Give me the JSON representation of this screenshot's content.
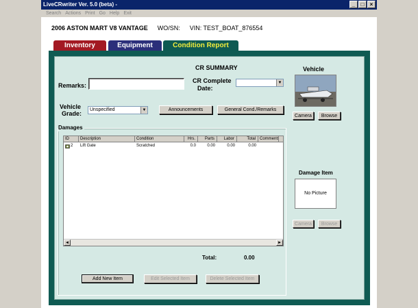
{
  "window": {
    "title": "LiveCRwriter Ver. 5.0 (beta) -"
  },
  "menu": [
    "Search",
    "Actions",
    "Print",
    "Go",
    "Help",
    "Exit"
  ],
  "vehicle_header": {
    "year_make_model": "2006 ASTON MART V8 VANTAGE",
    "wo_label": "WO/SN:",
    "vin": "VIN: TEST_BOAT_876554"
  },
  "tabs": [
    {
      "label": "Inventory",
      "color": "#a31923"
    },
    {
      "label": "Equipment",
      "color": "#2b2f7a"
    },
    {
      "label": "Condition Report",
      "color": "#0e5a52",
      "selected": true
    }
  ],
  "cr": {
    "summary_title": "CR SUMMARY",
    "remarks_label": "Remarks:",
    "remarks_value": "",
    "complete_date_label_1": "CR Complete",
    "complete_date_label_2": "Date:",
    "complete_date_value": "",
    "grade_label_1": "Vehicle",
    "grade_label_2": "Grade:",
    "grade_value": "Unspecified",
    "announcements_button": "Announcements",
    "general_cond_button": "General Cond./Remarks"
  },
  "vehicle_panel": {
    "title": "Vehicle",
    "camera_button": "Camera",
    "browse_button": "Browse"
  },
  "damages": {
    "group_label": "Damages",
    "columns": [
      "ID",
      "Description",
      "Condition",
      "Hrs.",
      "Parts",
      "Labor",
      "Total",
      "Comments"
    ],
    "rows": [
      {
        "id": "2",
        "description": "Lift Gate",
        "condition": "Scratched",
        "hrs": "0.0",
        "parts": "0.00",
        "labor": "0.00",
        "total": "0.00",
        "comments": ""
      }
    ],
    "total_label": "Total:",
    "total_value": "0.00",
    "add_button": "Add New Item",
    "edit_button": "Edit Selected Item",
    "delete_button": "Delete Selected Item"
  },
  "damage_item_panel": {
    "title": "Damage Item",
    "no_picture": "No Picture",
    "camera_button": "Camera",
    "browse_button": "Browse"
  }
}
